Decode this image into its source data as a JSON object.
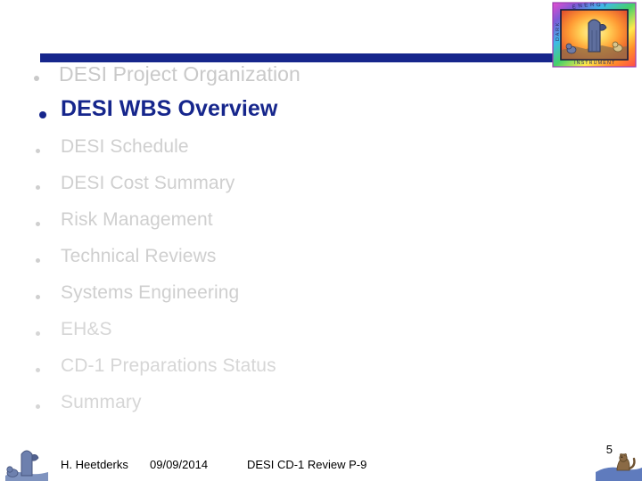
{
  "slide": {
    "accent_color": "#16268c",
    "dim_color": "#c9c9c9",
    "dim_color_light": "#d6d6d6",
    "title_rule": "horizontal-rule"
  },
  "logo": {
    "name": "desi-doe-logo",
    "top_text": "ENERGY",
    "left_text": "DARK",
    "bottom_text": "INSTRUMENT",
    "border_colors": [
      "#e84bd0",
      "#7b5bd6",
      "#3fb9e8",
      "#46d06a",
      "#ffe84a",
      "#ff8c2a",
      "#ff4a4a"
    ],
    "field_colors": [
      "#ffe97a",
      "#ffa23c",
      "#e8613c"
    ]
  },
  "outline": {
    "items": [
      {
        "label": "DESI Project Organization",
        "style": "dim1"
      },
      {
        "label": "DESI WBS Overview",
        "style": "active"
      },
      {
        "label": "DESI Schedule",
        "style": "dim2"
      },
      {
        "label": "DESI Cost Summary",
        "style": "dim2"
      },
      {
        "label": "Risk Management",
        "style": "dim2"
      },
      {
        "label": "Technical Reviews",
        "style": "dim2"
      },
      {
        "label": "Systems Engineering",
        "style": "dim2"
      },
      {
        "label": "EH&S",
        "style": "dim3"
      },
      {
        "label": "CD-1 Preparations Status",
        "style": "dim3"
      },
      {
        "label": "Summary",
        "style": "dim3"
      }
    ]
  },
  "footer": {
    "author": "H. Heetderks",
    "date": "09/09/2014",
    "review": "DESI CD-1 Review  P-9",
    "page_number": "5",
    "icon_name": "telescope-dome-icon",
    "corner_icon_name": "prairie-dog-icon"
  }
}
